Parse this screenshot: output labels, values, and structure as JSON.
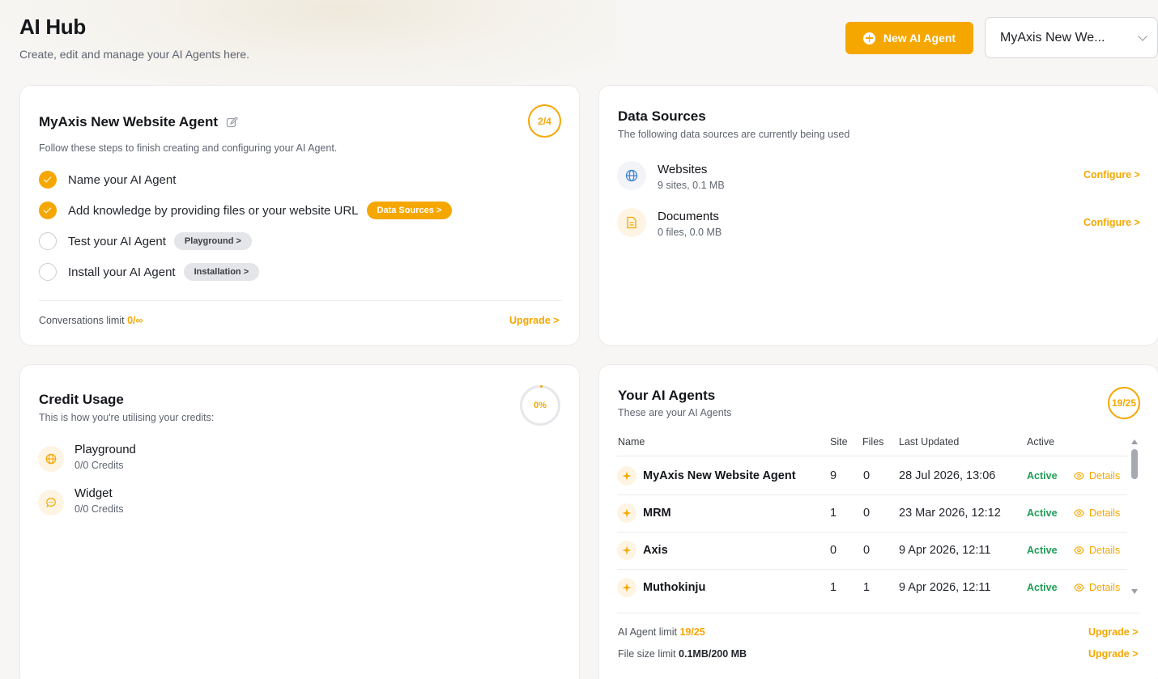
{
  "header": {
    "title": "AI Hub",
    "subtitle": "Create, edit and manage your AI Agents here.",
    "new_agent_label": "New AI Agent",
    "agent_select_value": "MyAxis New We..."
  },
  "setup": {
    "title": "MyAxis New Website Agent",
    "progress": "2/4",
    "subtitle": "Follow these steps to finish creating and configuring your AI Agent.",
    "steps": [
      {
        "label": "Name your AI Agent",
        "done": true,
        "pill": ""
      },
      {
        "label": "Add knowledge by providing files or your website URL",
        "done": true,
        "pill": "Data Sources >"
      },
      {
        "label": "Test your AI Agent",
        "done": false,
        "pill": "Playground >"
      },
      {
        "label": "Install your AI Agent",
        "done": false,
        "pill": "Installation >"
      }
    ],
    "conversations_label": "Conversations limit",
    "conversations_value": "0/∞",
    "upgrade_label": "Upgrade >"
  },
  "data_sources": {
    "title": "Data Sources",
    "subtitle": "The following data sources are currently being used",
    "items": [
      {
        "name": "Websites",
        "meta": "9 sites, 0.1 MB",
        "action": "Configure >",
        "icon": "globe-icon"
      },
      {
        "name": "Documents",
        "meta": "0 files, 0.0 MB",
        "action": "Configure >",
        "icon": "document-icon"
      }
    ]
  },
  "credits": {
    "title": "Credit Usage",
    "subtitle": "This is how you're utilising your credits:",
    "percent": "0%",
    "items": [
      {
        "name": "Playground",
        "meta": "0/0 Credits",
        "icon": "globe-icon"
      },
      {
        "name": "Widget",
        "meta": "0/0 Credits",
        "icon": "chat-bubble-icon"
      }
    ]
  },
  "agents": {
    "title": "Your AI Agents",
    "subtitle": "These are your AI Agents",
    "count": "19/25",
    "columns": {
      "name": "Name",
      "site": "Site",
      "files": "Files",
      "updated": "Last Updated",
      "active": "Active"
    },
    "rows": [
      {
        "name": "MyAxis New Website Agent",
        "site": "9",
        "files": "0",
        "updated": "28 Jul 2026, 13:06",
        "status": "Active",
        "details": "Details"
      },
      {
        "name": "MRM",
        "site": "1",
        "files": "0",
        "updated": "23 Mar 2026, 12:12",
        "status": "Active",
        "details": "Details"
      },
      {
        "name": "Axis",
        "site": "0",
        "files": "0",
        "updated": "9 Apr 2026, 12:11",
        "status": "Active",
        "details": "Details"
      },
      {
        "name": "Muthokinju",
        "site": "1",
        "files": "1",
        "updated": "9 Apr 2026, 12:11",
        "status": "Active",
        "details": "Details"
      }
    ],
    "agent_limit_label": "AI Agent limit",
    "agent_limit_value": "19/25",
    "file_limit_label": "File size limit",
    "file_limit_value": "0.1MB/200 MB",
    "upgrade_label": "Upgrade >"
  },
  "colors": {
    "accent": "#f5a700",
    "active_green": "#1f9d55",
    "background": "#f7f6f4"
  }
}
